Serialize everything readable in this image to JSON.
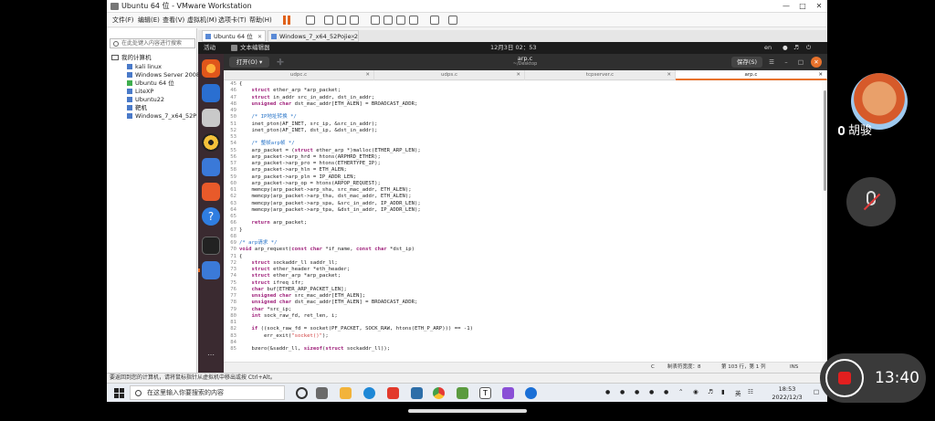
{
  "vmware": {
    "title": "Ubuntu 64 位 - VMware Workstation",
    "menu": [
      "文件(F)",
      "编辑(E)",
      "查看(V)",
      "虚拟机(M)",
      "选项卡(T)",
      "帮助(H)"
    ],
    "library": {
      "search_placeholder": "在此处键入内容进行搜索",
      "root": "我的计算机",
      "items": [
        "kali linux",
        "Windows Server 2008",
        "Ubuntu 64 位",
        "LiteXP",
        "Ubuntu22",
        "靶机",
        "Windows_7_x64_52Pojie_2"
      ]
    },
    "tabs": [
      {
        "label": "Ubuntu 64 位"
      },
      {
        "label": "Windows_7_x64_52Pojie_2"
      }
    ],
    "status": "要返回到您的计算机，请将鼠标指针从虚拟机中移出或按 Ctrl+Alt。"
  },
  "ubuntu": {
    "activities": "活动",
    "app_name": "文本编辑器",
    "datetime": "12月3日 02：53",
    "lang": "en",
    "gedit": {
      "open_label": "打开(O)",
      "title": "arp.c",
      "subtitle": "~/Desktop",
      "save_label": "保存(S)",
      "doc_tabs": [
        "udpc.c",
        "udps.c",
        "tcpserver.c",
        "arp.c"
      ],
      "status": {
        "lang": "C",
        "tab_width": "制表符宽度：8",
        "position": "第 103 行，第 1 列",
        "mode": "INS"
      }
    }
  },
  "code": [
    {
      "n": "45",
      "t": "{"
    },
    {
      "n": "46",
      "t": "    <k>struct</k> ether_arp *arp_packet;"
    },
    {
      "n": "47",
      "t": "    <k>struct</k> in_addr src_in_addr, dst_in_addr;"
    },
    {
      "n": "48",
      "t": "    <k>unsigned char</k> dst_mac_addr[ETH_ALEN] = BROADCAST_ADDR;"
    },
    {
      "n": "49",
      "t": ""
    },
    {
      "n": "50",
      "t": "    <c>/* IP地址转换 */</c>"
    },
    {
      "n": "51",
      "t": "    inet_pton(AF_INET, src_ip, &src_in_addr);"
    },
    {
      "n": "52",
      "t": "    inet_pton(AF_INET, dst_ip, &dst_in_addr);"
    },
    {
      "n": "53",
      "t": ""
    },
    {
      "n": "54",
      "t": "    <c>/* 整帧arp帧 */</c>"
    },
    {
      "n": "55",
      "t": "    arp_packet = (<k>struct</k> ether_arp *)malloc(ETHER_ARP_LEN);"
    },
    {
      "n": "56",
      "t": "    arp_packet->arp_hrd = htons(ARPHRD_ETHER);"
    },
    {
      "n": "57",
      "t": "    arp_packet->arp_pro = htons(ETHERTYPE_IP);"
    },
    {
      "n": "58",
      "t": "    arp_packet->arp_hln = ETH_ALEN;"
    },
    {
      "n": "59",
      "t": "    arp_packet->arp_pln = IP_ADDR_LEN;"
    },
    {
      "n": "60",
      "t": "    arp_packet->arp_op = htons(ARPOP_REQUEST);"
    },
    {
      "n": "61",
      "t": "    memcpy(arp_packet->arp_sha, src_mac_addr, ETH_ALEN);"
    },
    {
      "n": "62",
      "t": "    memcpy(arp_packet->arp_tha, dst_mac_addr, ETH_ALEN);"
    },
    {
      "n": "63",
      "t": "    memcpy(arp_packet->arp_spa, &src_in_addr, IP_ADDR_LEN);"
    },
    {
      "n": "64",
      "t": "    memcpy(arp_packet->arp_tpa, &dst_in_addr, IP_ADDR_LEN);"
    },
    {
      "n": "65",
      "t": ""
    },
    {
      "n": "66",
      "t": "    <k>return</k> arp_packet;"
    },
    {
      "n": "67",
      "t": "}"
    },
    {
      "n": "68",
      "t": ""
    },
    {
      "n": "69",
      "t": "<c>/* arp请求 */</c>"
    },
    {
      "n": "70",
      "t": "<k>void</k> arp_request(<k>const char</k> *if_name, <k>const char</k> *dst_ip)"
    },
    {
      "n": "71",
      "t": "{"
    },
    {
      "n": "72",
      "t": "    <k>struct</k> sockaddr_ll saddr_ll;"
    },
    {
      "n": "73",
      "t": "    <k>struct</k> ether_header *eth_header;"
    },
    {
      "n": "74",
      "t": "    <k>struct</k> ether_arp *arp_packet;"
    },
    {
      "n": "75",
      "t": "    <k>struct</k> ifreq ifr;"
    },
    {
      "n": "76",
      "t": "    <k>char</k> buf[ETHER_ARP_PACKET_LEN];"
    },
    {
      "n": "77",
      "t": "    <k>unsigned char</k> src_mac_addr[ETH_ALEN];"
    },
    {
      "n": "78",
      "t": "    <k>unsigned char</k> dst_mac_addr[ETH_ALEN] = BROADCAST_ADDR;"
    },
    {
      "n": "79",
      "t": "    <k>char</k> *src_ip;"
    },
    {
      "n": "80",
      "t": "    <k>int</k> sock_raw_fd, ret_len, i;"
    },
    {
      "n": "81",
      "t": ""
    },
    {
      "n": "82",
      "t": "    <k>if</k> ((sock_raw_fd = socket(PF_PACKET, SOCK_RAW, htons(ETH_P_ARP))) == -1)"
    },
    {
      "n": "83",
      "t": "        err_exit(<s>\"socket()\"</s>);"
    },
    {
      "n": "84",
      "t": ""
    },
    {
      "n": "85",
      "t": "    bzero(&saddr_ll, <k>sizeof</k>(<k>struct</k> sockaddr_ll));"
    }
  ],
  "taskbar": {
    "search_placeholder": "在这里输入你要搜索的内容",
    "tray_lang": "英",
    "time": "18:53",
    "date": "2022/12/3"
  },
  "call": {
    "caller_name": "胡骏",
    "rec_time": "13:40"
  },
  "colors": {
    "ubuntu_orange": "#e8722c",
    "dock_bg": "#3a2a30",
    "record_red": "#e21f1f"
  }
}
